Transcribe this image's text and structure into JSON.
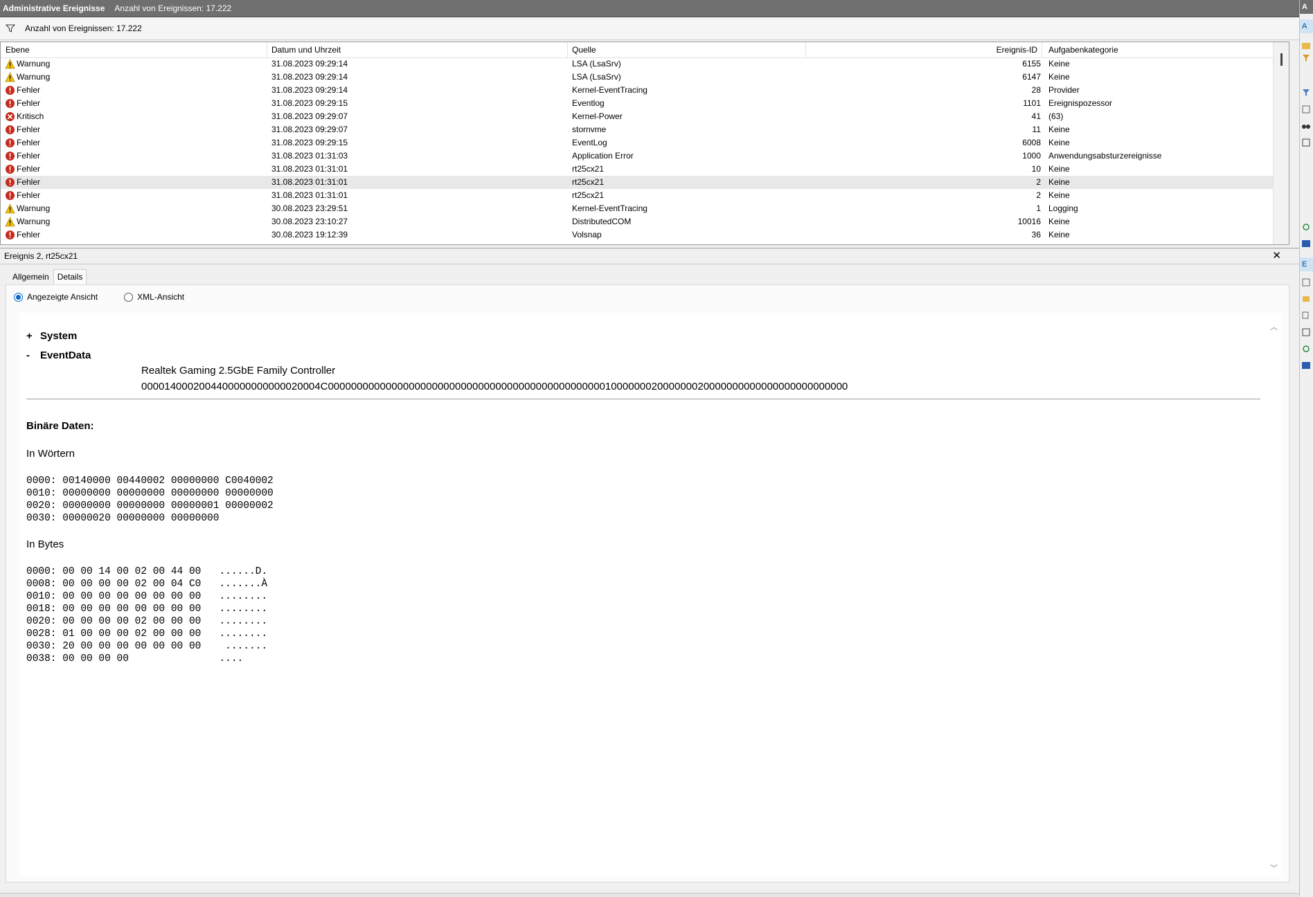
{
  "titlebar": {
    "title": "Administrative Ereignisse",
    "count": "Anzahl von Ereignissen: 17.222"
  },
  "filterbar": {
    "icon": "filter-icon",
    "text": "Anzahl von Ereignissen: 17.222"
  },
  "list": {
    "columns": [
      "Ebene",
      "Datum und Uhrzeit",
      "Quelle",
      "Ereignis-ID",
      "Aufgabenkategorie"
    ],
    "rows": [
      {
        "level": "Warnung",
        "icon": "warning-icon",
        "date": "31.08.2023 09:29:14",
        "source": "LSA (LsaSrv)",
        "id": "6155",
        "category": "Keine"
      },
      {
        "level": "Warnung",
        "icon": "warning-icon",
        "date": "31.08.2023 09:29:14",
        "source": "LSA (LsaSrv)",
        "id": "6147",
        "category": "Keine"
      },
      {
        "level": "Fehler",
        "icon": "error-icon",
        "date": "31.08.2023 09:29:14",
        "source": "Kernel-EventTracing",
        "id": "28",
        "category": "Provider"
      },
      {
        "level": "Fehler",
        "icon": "error-icon",
        "date": "31.08.2023 09:29:15",
        "source": "Eventlog",
        "id": "1101",
        "category": "Ereignispozessor"
      },
      {
        "level": "Kritisch",
        "icon": "critical-icon",
        "date": "31.08.2023 09:29:07",
        "source": "Kernel-Power",
        "id": "41",
        "category": "(63)"
      },
      {
        "level": "Fehler",
        "icon": "error-icon",
        "date": "31.08.2023 09:29:07",
        "source": "stornvme",
        "id": "11",
        "category": "Keine"
      },
      {
        "level": "Fehler",
        "icon": "error-icon",
        "date": "31.08.2023 09:29:15",
        "source": "EventLog",
        "id": "6008",
        "category": "Keine"
      },
      {
        "level": "Fehler",
        "icon": "error-icon",
        "date": "31.08.2023 01:31:03",
        "source": "Application Error",
        "id": "1000",
        "category": "Anwendungsabsturzereignisse"
      },
      {
        "level": "Fehler",
        "icon": "error-icon",
        "date": "31.08.2023 01:31:01",
        "source": "rt25cx21",
        "id": "10",
        "category": "Keine"
      },
      {
        "level": "Fehler",
        "icon": "error-icon",
        "date": "31.08.2023 01:31:01",
        "source": "rt25cx21",
        "id": "2",
        "category": "Keine",
        "selected": true
      },
      {
        "level": "Fehler",
        "icon": "error-icon",
        "date": "31.08.2023 01:31:01",
        "source": "rt25cx21",
        "id": "2",
        "category": "Keine"
      },
      {
        "level": "Warnung",
        "icon": "warning-icon",
        "date": "30.08.2023 23:29:51",
        "source": "Kernel-EventTracing",
        "id": "1",
        "category": "Logging"
      },
      {
        "level": "Warnung",
        "icon": "warning-icon",
        "date": "30.08.2023 23:10:27",
        "source": "DistributedCOM",
        "id": "10016",
        "category": "Keine"
      },
      {
        "level": "Fehler",
        "icon": "error-icon",
        "date": "30.08.2023 19:12:39",
        "source": "Volsnap",
        "id": "36",
        "category": "Keine"
      }
    ]
  },
  "detail": {
    "title": "Ereignis 2, rt25cx21",
    "close": "✕",
    "tabs": [
      "Allgemein",
      "Details"
    ],
    "active_tab": "Details",
    "view_options": [
      "Angezeigte Ansicht",
      "XML-Ansicht"
    ],
    "selected_view": "Angezeigte Ansicht",
    "tree": [
      {
        "sign": "+",
        "label": "System"
      },
      {
        "sign": "-",
        "label": "EventData"
      }
    ],
    "eventdata": [
      "Realtek Gaming 2.5GbE Family Controller",
      "0000140002004400000000000020004C000000000000000000000000000000000000000000000000100000002000000020000000000000000000000000"
    ],
    "binary_title": "Binäre Daten:",
    "words_title": "In Wörtern",
    "words": [
      "0000: 00140000 00440002 00000000 C0040002",
      "0010: 00000000 00000000 00000000 00000000",
      "0020: 00000000 00000000 00000001 00000002",
      "0030: 00000020 00000000 00000000"
    ],
    "bytes_title": "In Bytes",
    "bytes": [
      "0000: 00 00 14 00 02 00 44 00   ......D.",
      "0008: 00 00 00 00 02 00 04 C0   .......À",
      "0010: 00 00 00 00 00 00 00 00   ........",
      "0018: 00 00 00 00 00 00 00 00   ........",
      "0020: 00 00 00 00 02 00 00 00   ........",
      "0028: 01 00 00 00 02 00 00 00   ........",
      "0030: 20 00 00 00 00 00 00 00    .......",
      "0038: 00 00 00 00               ...."
    ]
  },
  "actions": {
    "head": "A",
    "selected": "E"
  },
  "colors": {
    "titlebar": "#6f6f6f",
    "warning": "#f5c400",
    "error": "#c42b1c",
    "selected_row": "#e8e8e8",
    "radio_accent": "#0a64c8"
  }
}
